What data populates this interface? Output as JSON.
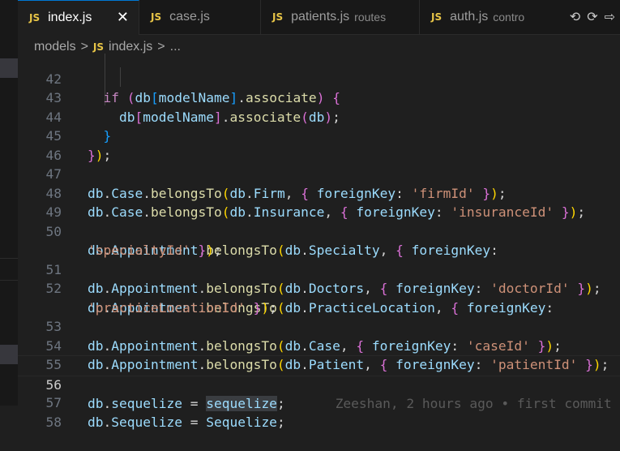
{
  "tabs": [
    {
      "badge": "JS",
      "label": "index.js",
      "hint": "",
      "active": true
    },
    {
      "badge": "JS",
      "label": "case.js",
      "hint": "",
      "active": false
    },
    {
      "badge": "JS",
      "label": "patients.js",
      "hint": "routes",
      "active": false
    },
    {
      "badge": "JS",
      "label": "auth.js",
      "hint": "contro",
      "active": false
    }
  ],
  "tab_close_glyph": "✕",
  "tab_actions": [
    "⟲",
    "⟳",
    "⇨"
  ],
  "breadcrumb": {
    "folder": "models",
    "separator": ">",
    "file_badge": "JS",
    "file": "index.js",
    "tail": "..."
  },
  "lines": [
    {
      "n": "42",
      "code": "  if (db[modelName].associate) {"
    },
    {
      "n": "43",
      "code": "    db[modelName].associate(db);"
    },
    {
      "n": "44",
      "code": "  }"
    },
    {
      "n": "45",
      "code": "});"
    },
    {
      "n": "46",
      "code": ""
    },
    {
      "n": "47",
      "code": "db.Case.belongsTo(db.Firm, { foreignKey: 'firmId' });"
    },
    {
      "n": "48",
      "code": "db.Case.belongsTo(db.Insurance, { foreignKey: 'insuranceId' });"
    },
    {
      "n": "49",
      "code": ""
    },
    {
      "n": "50",
      "code": "db.Appointment.belongsTo(db.Specialty, { foreignKey: 'specialtyId' });"
    },
    {
      "n": "51",
      "code": "db.Appointment.belongsTo(db.Doctors, { foreignKey: 'doctorId' });"
    },
    {
      "n": "52",
      "code": "db.Appointment.belongsTo(db.PracticeLocation, { foreignKey: 'practiceLocationId' });"
    },
    {
      "n": "53",
      "code": "db.Appointment.belongsTo(db.Case, { foreignKey: 'caseId' });"
    },
    {
      "n": "54",
      "code": "db.Appointment.belongsTo(db.Patient, { foreignKey: 'patientId' });"
    },
    {
      "n": "55",
      "code": ""
    },
    {
      "n": "56",
      "code": "db.sequelize = sequelize;"
    },
    {
      "n": "57",
      "code": "db.Sequelize = Sequelize;"
    },
    {
      "n": "58",
      "code": ""
    }
  ],
  "blame": "Zeeshan, 2 hours ago • first commit",
  "colors": {
    "accent": "#0078d4",
    "js_badge": "#e8c547",
    "variable": "#9cdcfe",
    "function": "#dcdcaa",
    "string": "#ce9178",
    "keyword": "#c586c0"
  }
}
